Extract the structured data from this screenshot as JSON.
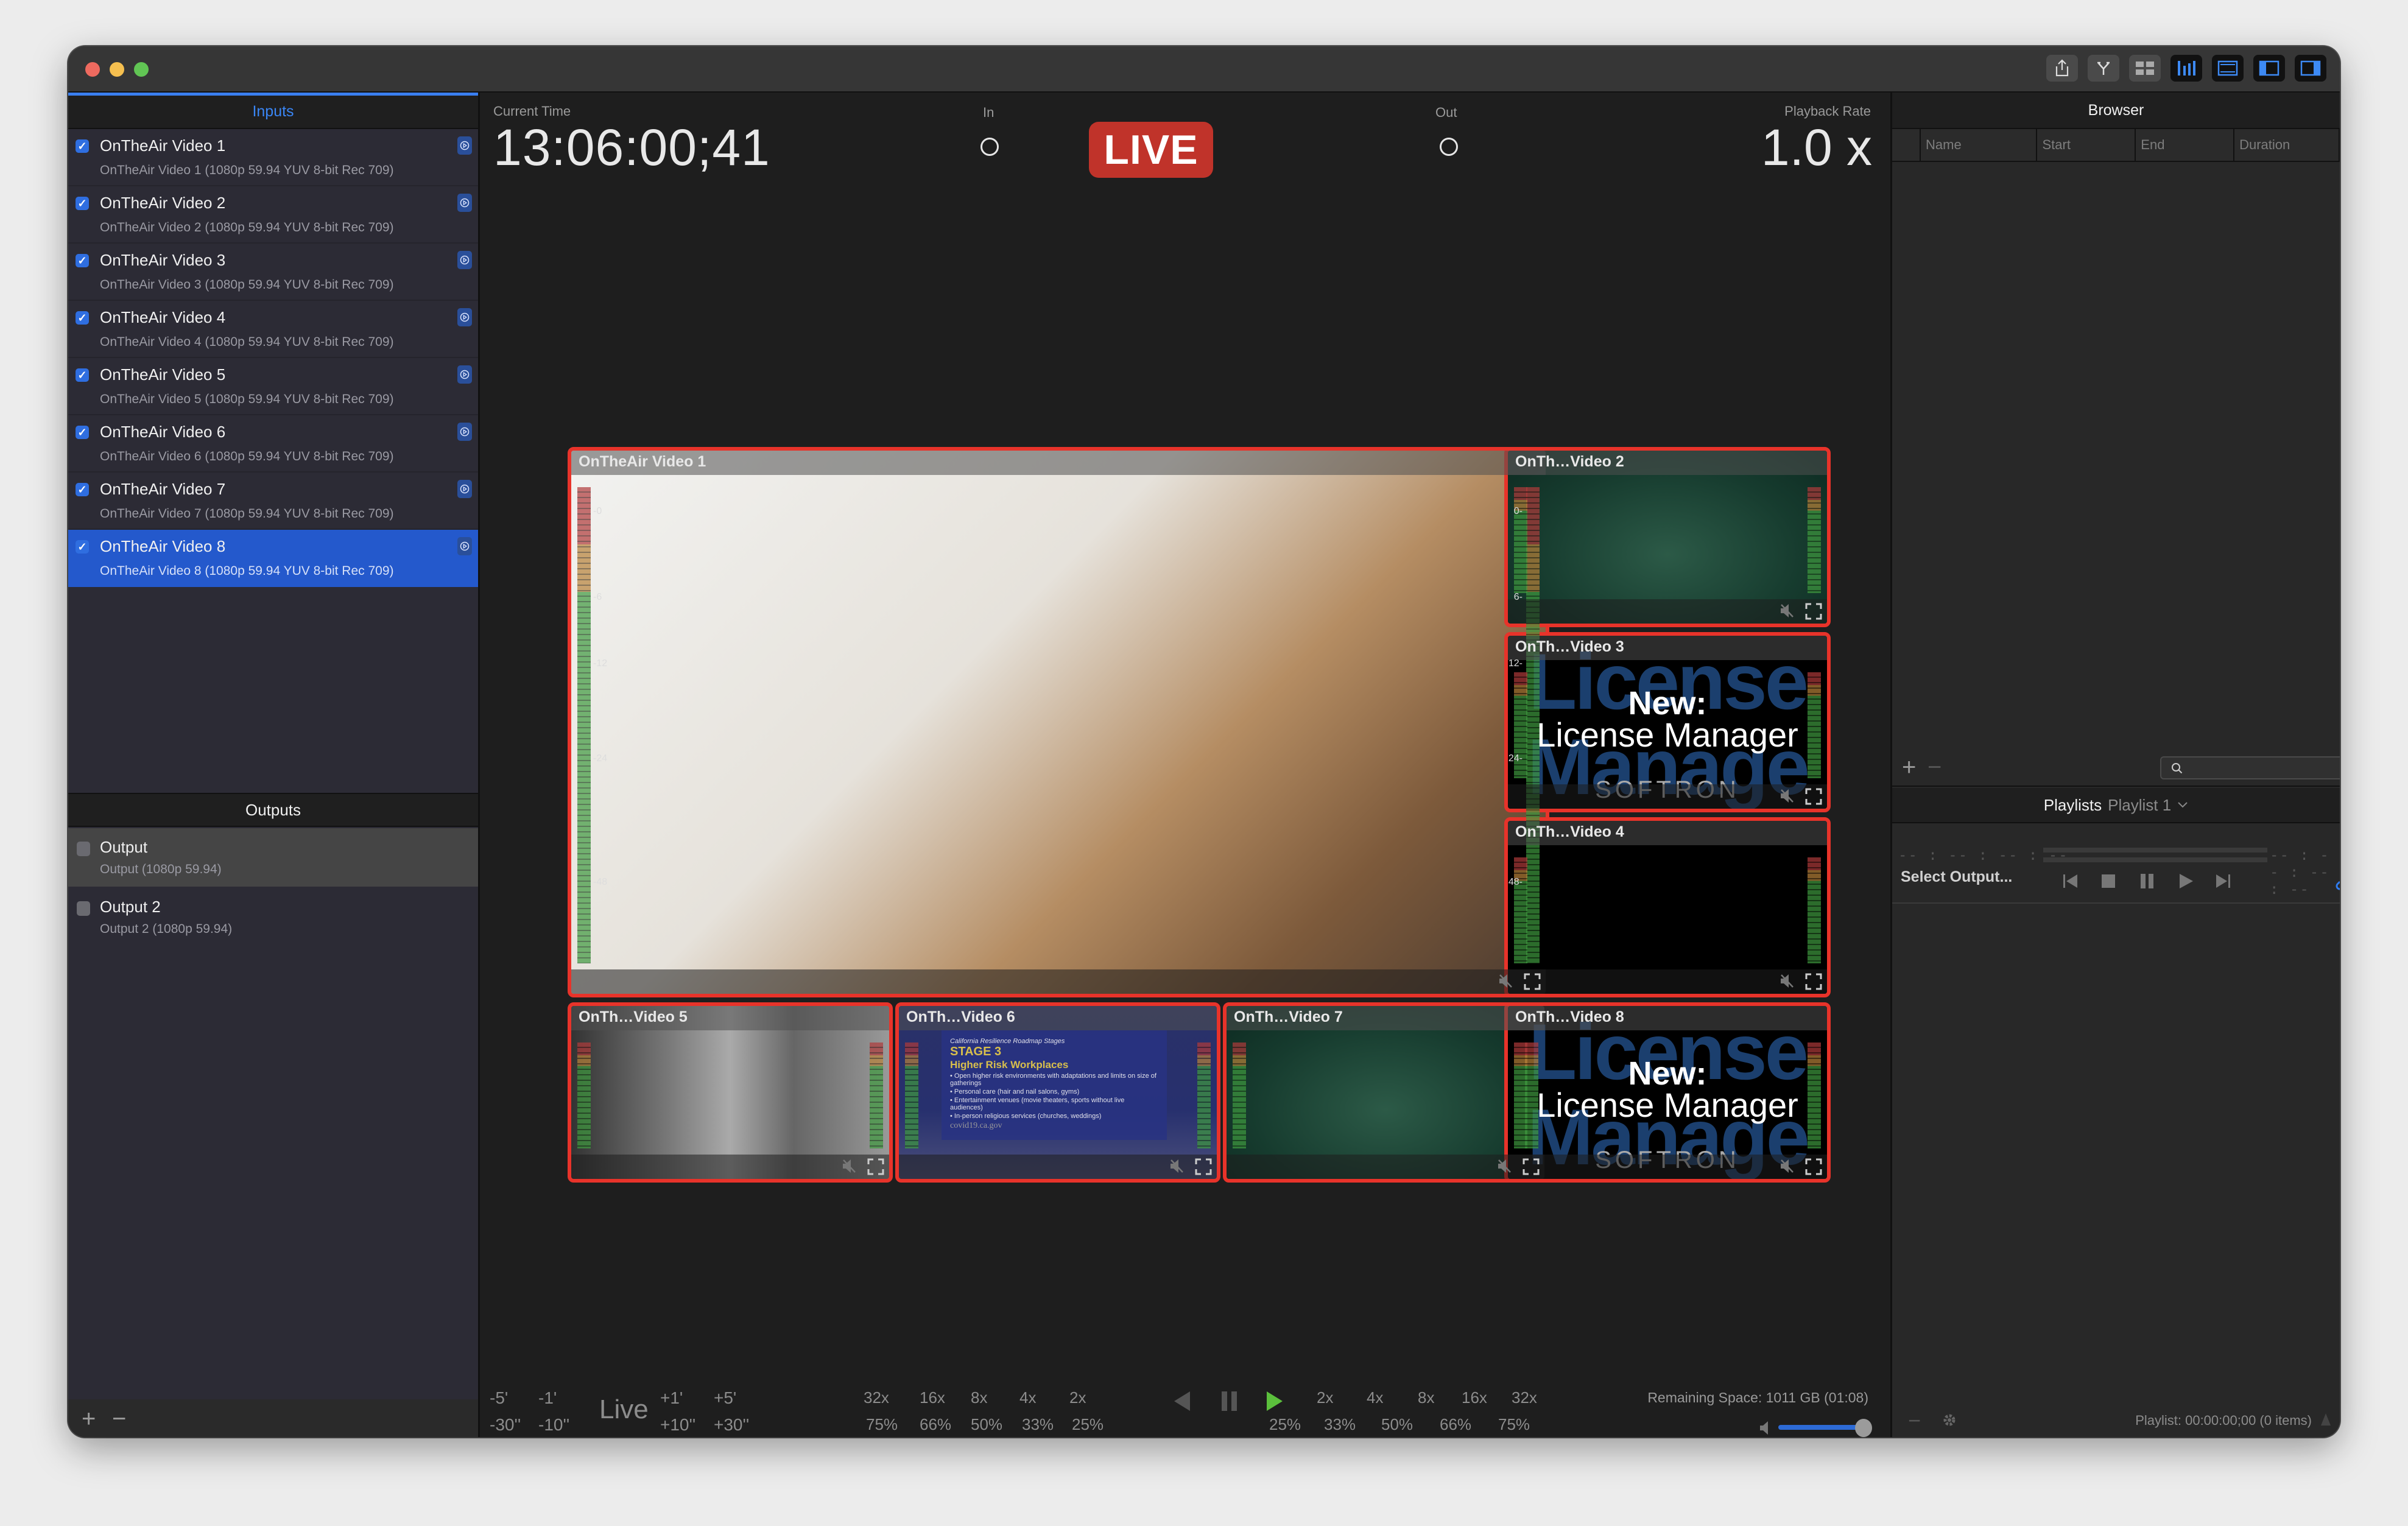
{
  "window": {
    "toolbar_buttons": [
      {
        "name": "share-icon",
        "style": "grey"
      },
      {
        "name": "fork-icon",
        "style": "grey"
      },
      {
        "name": "grid-icon",
        "style": "grey"
      },
      {
        "name": "audio-meters-icon",
        "style": "dark"
      },
      {
        "name": "monitor-layout-icon",
        "style": "dark"
      },
      {
        "name": "left-sidebar-icon",
        "style": "dark"
      },
      {
        "name": "right-sidebar-icon",
        "style": "dark"
      }
    ]
  },
  "sidebar": {
    "inputs_title": "Inputs",
    "inputs": [
      {
        "title": "OnTheAir Video 1",
        "sub": "OnTheAir Video 1 (1080p 59.94 YUV 8-bit Rec 709)",
        "checked": true
      },
      {
        "title": "OnTheAir Video 2",
        "sub": "OnTheAir Video 2 (1080p 59.94 YUV 8-bit Rec 709)",
        "checked": true
      },
      {
        "title": "OnTheAir Video 3",
        "sub": "OnTheAir Video 3 (1080p 59.94 YUV 8-bit Rec 709)",
        "checked": true
      },
      {
        "title": "OnTheAir Video 4",
        "sub": "OnTheAir Video 4 (1080p 59.94 YUV 8-bit Rec 709)",
        "checked": true
      },
      {
        "title": "OnTheAir Video 5",
        "sub": "OnTheAir Video 5 (1080p 59.94 YUV 8-bit Rec 709)",
        "checked": true
      },
      {
        "title": "OnTheAir Video 6",
        "sub": "OnTheAir Video 6 (1080p 59.94 YUV 8-bit Rec 709)",
        "checked": true
      },
      {
        "title": "OnTheAir Video 7",
        "sub": "OnTheAir Video 7 (1080p 59.94 YUV 8-bit Rec 709)",
        "checked": true
      },
      {
        "title": "OnTheAir Video 8",
        "sub": "OnTheAir Video 8 (1080p 59.94 YUV 8-bit Rec 709)",
        "checked": true,
        "selected": true
      }
    ],
    "outputs_title": "Outputs",
    "outputs": [
      {
        "title": "Output",
        "sub": "Output (1080p 59.94)",
        "checked": false,
        "highlighted": true
      },
      {
        "title": "Output 2",
        "sub": "Output 2 (1080p 59.94)",
        "checked": false
      }
    ],
    "add_label": "+",
    "remove_label": "−"
  },
  "header": {
    "current_time_label": "Current Time",
    "current_time": "13:06:00;41",
    "in_label": "In",
    "out_label": "Out",
    "live_badge": "LIVE",
    "playback_rate_label": "Playback Rate",
    "playback_rate": "1.0 x"
  },
  "tiles": [
    {
      "label": "OnTheAir Video 1",
      "bg": "room",
      "main": true,
      "scale_left": [
        "-0",
        "-6",
        "-12",
        "-24",
        "-48"
      ],
      "scale_right": [
        "0-",
        "6-",
        "12-",
        "24-",
        "48-"
      ]
    },
    {
      "label": "OnTh…Video 2",
      "bg": "sea"
    },
    {
      "label": "OnTh…Video 3",
      "bg": "license"
    },
    {
      "label": "OnTh…Video 4",
      "bg": "black"
    },
    {
      "label": "OnTh…Video 5",
      "bg": "bw"
    },
    {
      "label": "OnTh…Video 6",
      "bg": "slide"
    },
    {
      "label": "OnTh…Video 7",
      "bg": "sea"
    },
    {
      "label": "OnTh…Video 8",
      "bg": "license"
    }
  ],
  "license_slide": {
    "bg_top": "License",
    "bg_bottom": "Manage",
    "new": "New:",
    "title": "License Manager",
    "brand": "SOFTRON"
  },
  "stage_slide": {
    "caption": "California Resilience Roadmap Stages",
    "stage": "STAGE 3",
    "heading": "Higher Risk Workplaces",
    "lines": [
      "• Open higher risk environments with adaptations and limits on size of gatherings",
      "• Personal care (hair and nail salons, gyms)",
      "• Entertainment venues (movie theaters, sports without live audiences)",
      "• In-person religious services (churches, weddings)"
    ],
    "footer": "covid19.ca.gov"
  },
  "transport": {
    "jump_back_top": [
      "-5'",
      "-1'"
    ],
    "jump_back_bottom": [
      "-30''",
      "-10''"
    ],
    "live_label": "Live",
    "jump_fwd_top": [
      "+1'",
      "+5'"
    ],
    "jump_fwd_bottom": [
      "+10''",
      "+30''"
    ],
    "rewind_speeds": [
      "32x",
      "16x",
      "8x",
      "4x",
      "2x"
    ],
    "slow_rev": [
      "75%",
      "66%",
      "50%",
      "33%",
      "25%"
    ],
    "forward_speeds": [
      "2x",
      "4x",
      "8x",
      "16x",
      "32x"
    ],
    "slow_fwd": [
      "25%",
      "33%",
      "50%",
      "66%",
      "75%"
    ],
    "remaining_space": "Remaining Space: 1011 GB (01:08)",
    "volume_percent": 100,
    "play_color": "#5bbf3c"
  },
  "browser": {
    "title": "Browser",
    "columns": [
      "Name",
      "Start",
      "End",
      "Duration"
    ],
    "search_placeholder": "",
    "add_label": "+",
    "remove_label": "−"
  },
  "playlists": {
    "title": "Playlists",
    "selected": "Playlist 1",
    "timecode_left": "-- : -- : -- : --",
    "timecode_right": "-- : -- : -- : --",
    "select_output": "Select Output...",
    "status": "Playlist: 00:00:00;00 (0 items)",
    "remove_label": "−"
  },
  "colors": {
    "accent": "#3a86f5",
    "selection": "#2459cc",
    "live": "#c0332a",
    "tile_border": "#e8332a"
  }
}
